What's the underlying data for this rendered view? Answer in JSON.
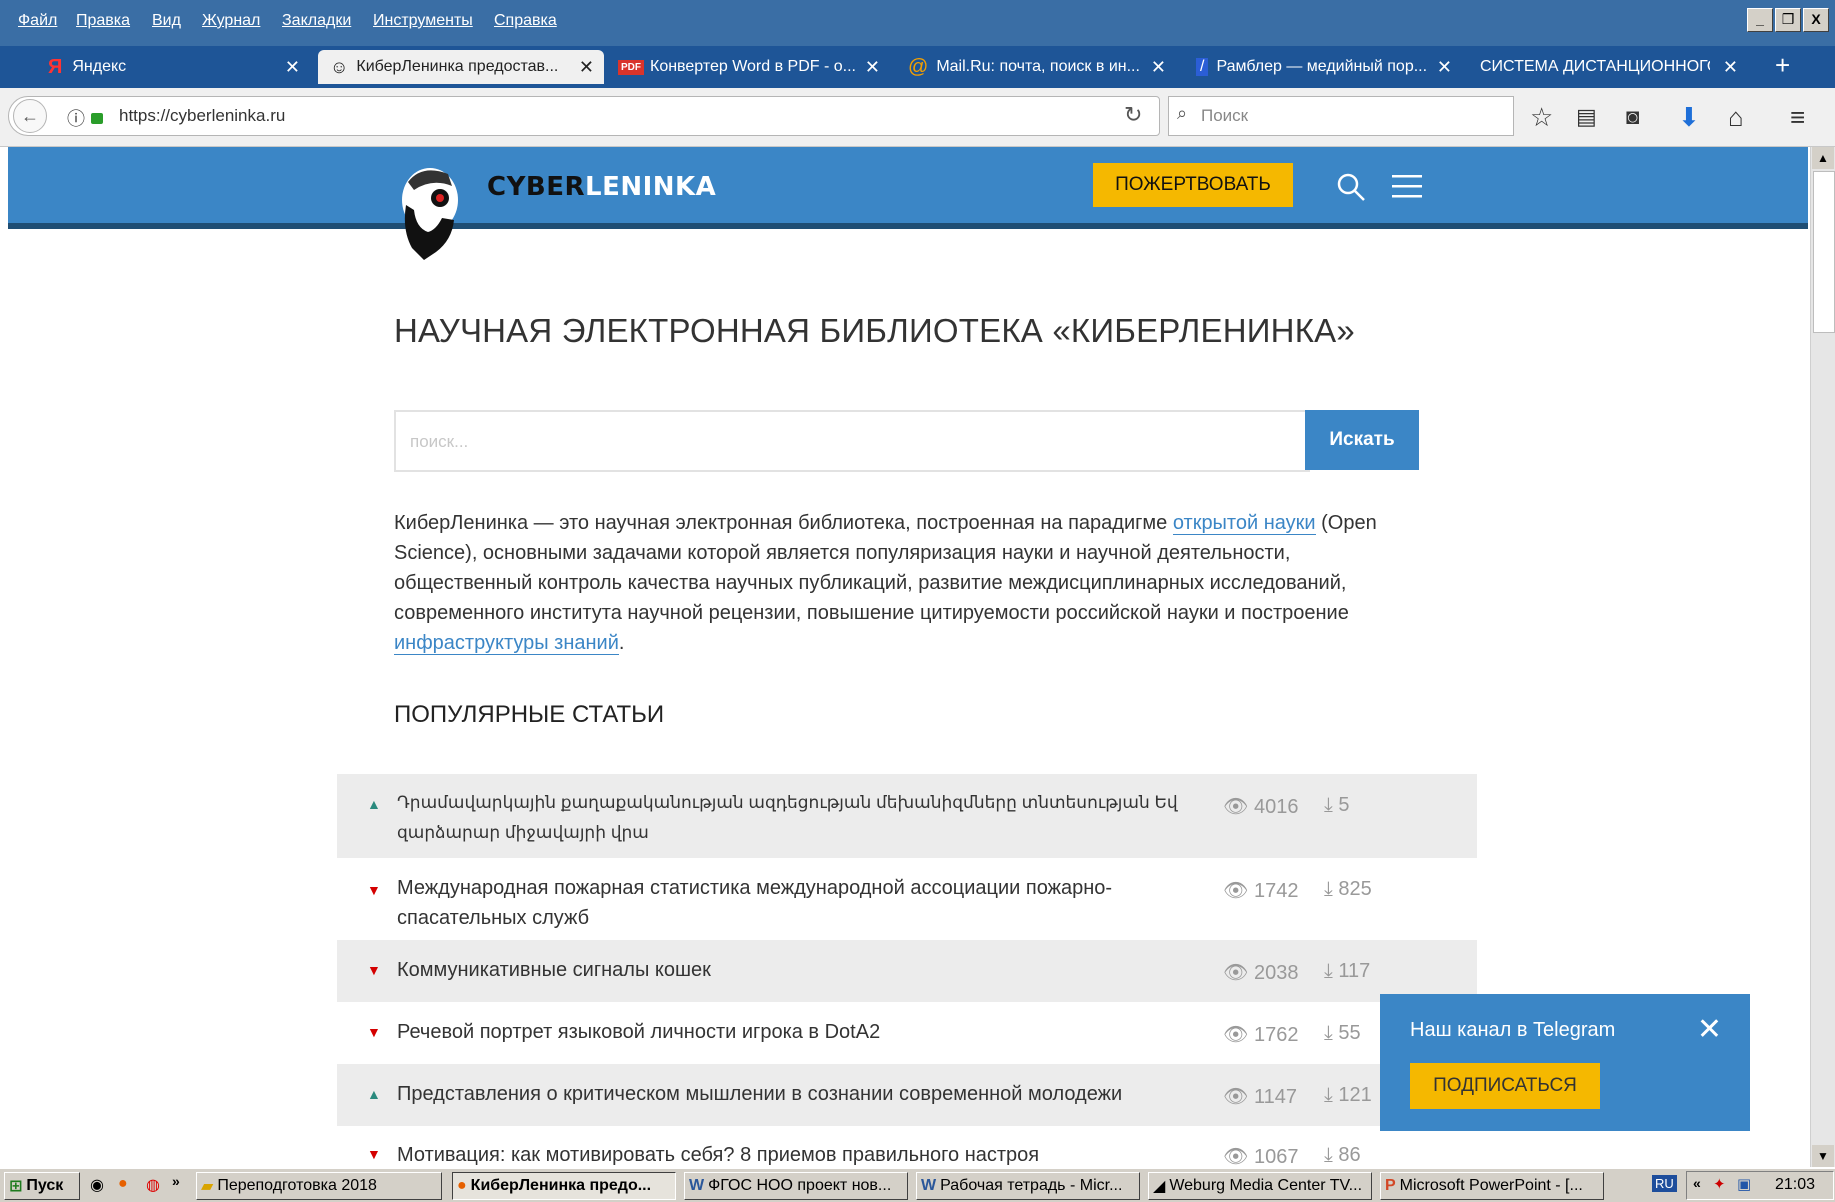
{
  "menubar": {
    "items": [
      "Файл",
      "Правка",
      "Вид",
      "Журнал",
      "Закладки",
      "Инструменты",
      "Справка"
    ],
    "window_buttons": [
      "_",
      "&#9645;",
      "X"
    ]
  },
  "tabs": [
    {
      "label": "Яндекс",
      "icon": "yandex-icon"
    },
    {
      "label": "КиберЛенинка предостав...",
      "icon": "cyberleninka-icon"
    },
    {
      "label": "Конвертер Word в PDF - о...",
      "icon": "pdf-icon"
    },
    {
      "label": "Mail.Ru: почта, поиск в ин...",
      "icon": "mailru-icon"
    },
    {
      "label": "Рамблер — медийный пор...",
      "icon": "rambler-icon"
    },
    {
      "label": "СИСТЕМА ДИСТАНЦИОННОГО ...",
      "icon": "none"
    }
  ],
  "nav": {
    "url": "https://cyberleninka.ru",
    "search_placeholder": "Поиск"
  },
  "site": {
    "logo_text_a": "CYBER",
    "logo_text_b": "LENINKA",
    "donate": "ПОЖЕРТВОВАТЬ",
    "title": "НАУЧНАЯ ЭЛЕКТРОННАЯ БИБЛИОТЕКА «КИБЕРЛЕНИНКА»",
    "search_placeholder": "поиск...",
    "search_button": "Искать",
    "intro_1": "КиберЛенинка — это научная электронная библиотека, построенная на парадигме ",
    "intro_link_1": "открытой науки",
    "intro_2": " (Open Science), основными задачами которой является популяризация науки и научной деятельности, общественный контроль качества научных публикаций, развитие междисциплинарных исследований, современного института научной рецензии, повышение цитируемости российской науки и построение ",
    "intro_link_2": "инфраструктуры знаний",
    "intro_3": ".",
    "popular_title": "ПОПУЛЯРНЫЕ СТАТЬИ"
  },
  "articles": [
    {
      "trend": "up",
      "title": "Դրամավարկային քաղաքականության ազդեցության մեխանիզմները տնտեսության Եվ զարձարար միջավայրի վրա",
      "views": "4016",
      "downloads": "5"
    },
    {
      "trend": "down",
      "title": "Международная пожарная статистика международной ассоциации пожарно-спасательных служб",
      "views": "1742",
      "downloads": "825"
    },
    {
      "trend": "down",
      "title": "Коммуникативные сигналы кошек",
      "views": "2038",
      "downloads": "117"
    },
    {
      "trend": "down",
      "title": "Речевой портрет языковой личности игрока в DotA2",
      "views": "1762",
      "downloads": "55"
    },
    {
      "trend": "up",
      "title": "Представления о критическом мышлении в сознании современной молодежи",
      "views": "1147",
      "downloads": "121"
    },
    {
      "trend": "down",
      "title": "Мотивация: как мотивировать себя? 8 приемов правильного настроя",
      "views": "1067",
      "downloads": "86"
    }
  ],
  "telegram": {
    "title": "Наш канал в Telegram",
    "subscribe": "ПОДПИСАТЬСЯ"
  },
  "taskbar": {
    "start": "Пуск",
    "items": [
      "Переподготовка 2018",
      "КиберЛенинка предо...",
      "ФГОС НОО проект нов...",
      "Рабочая тетрадь - Micr...",
      "Weburg Media Center TV...",
      "Microsoft PowerPoint - [..."
    ],
    "lang": "RU",
    "clock": "21:03"
  },
  "colors": {
    "accent": "#3b86c6",
    "donate": "#f5b800",
    "trend_up": "#2a8a7e",
    "trend_down": "#d40000"
  }
}
